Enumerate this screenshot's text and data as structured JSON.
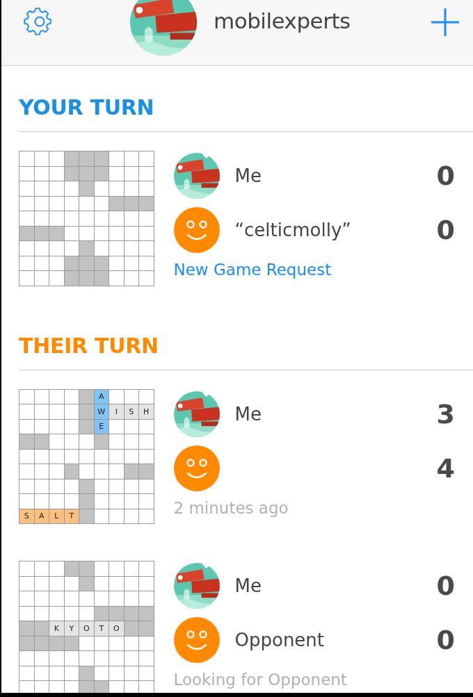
{
  "header": {
    "username": "mobilexperts"
  },
  "sections": [
    {
      "title": "YOUR TURN",
      "kind": "yours",
      "games": [
        {
          "board": [
            [
              {
                "kind": "empty"
              },
              {
                "kind": "empty"
              },
              {
                "kind": "empty"
              },
              {
                "kind": "blocked"
              },
              {
                "kind": "blocked"
              },
              {
                "kind": "blocked"
              },
              {
                "kind": "empty"
              },
              {
                "kind": "empty"
              },
              {
                "kind": "empty"
              }
            ],
            [
              {
                "kind": "empty"
              },
              {
                "kind": "empty"
              },
              {
                "kind": "empty"
              },
              {
                "kind": "blocked"
              },
              {
                "kind": "blocked"
              },
              {
                "kind": "blocked"
              },
              {
                "kind": "empty"
              },
              {
                "kind": "empty"
              },
              {
                "kind": "empty"
              }
            ],
            [
              {
                "kind": "empty"
              },
              {
                "kind": "empty"
              },
              {
                "kind": "empty"
              },
              {
                "kind": "empty"
              },
              {
                "kind": "blocked"
              },
              {
                "kind": "empty"
              },
              {
                "kind": "empty"
              },
              {
                "kind": "empty"
              },
              {
                "kind": "empty"
              }
            ],
            [
              {
                "kind": "empty"
              },
              {
                "kind": "empty"
              },
              {
                "kind": "empty"
              },
              {
                "kind": "empty"
              },
              {
                "kind": "empty"
              },
              {
                "kind": "empty"
              },
              {
                "kind": "blocked"
              },
              {
                "kind": "blocked"
              },
              {
                "kind": "blocked"
              }
            ],
            [
              {
                "kind": "empty"
              },
              {
                "kind": "empty"
              },
              {
                "kind": "empty"
              },
              {
                "kind": "empty"
              },
              {
                "kind": "empty"
              },
              {
                "kind": "empty"
              },
              {
                "kind": "empty"
              },
              {
                "kind": "empty"
              },
              {
                "kind": "empty"
              }
            ],
            [
              {
                "kind": "blocked"
              },
              {
                "kind": "blocked"
              },
              {
                "kind": "blocked"
              },
              {
                "kind": "empty"
              },
              {
                "kind": "empty"
              },
              {
                "kind": "empty"
              },
              {
                "kind": "empty"
              },
              {
                "kind": "empty"
              },
              {
                "kind": "empty"
              }
            ],
            [
              {
                "kind": "empty"
              },
              {
                "kind": "empty"
              },
              {
                "kind": "empty"
              },
              {
                "kind": "empty"
              },
              {
                "kind": "blocked"
              },
              {
                "kind": "empty"
              },
              {
                "kind": "empty"
              },
              {
                "kind": "empty"
              },
              {
                "kind": "empty"
              }
            ],
            [
              {
                "kind": "empty"
              },
              {
                "kind": "empty"
              },
              {
                "kind": "empty"
              },
              {
                "kind": "blocked"
              },
              {
                "kind": "blocked"
              },
              {
                "kind": "blocked"
              },
              {
                "kind": "empty"
              },
              {
                "kind": "empty"
              },
              {
                "kind": "empty"
              }
            ],
            [
              {
                "kind": "empty"
              },
              {
                "kind": "empty"
              },
              {
                "kind": "empty"
              },
              {
                "kind": "blocked"
              },
              {
                "kind": "blocked"
              },
              {
                "kind": "blocked"
              },
              {
                "kind": "empty"
              },
              {
                "kind": "empty"
              },
              {
                "kind": "empty"
              }
            ]
          ],
          "players": [
            {
              "name": "Me",
              "score": "0"
            },
            {
              "name": "“celticmolly”",
              "score": "0",
              "avatar": {
                "kind": "smiley"
              }
            }
          ],
          "status": {
            "kind": "link",
            "text": "New Game Request"
          }
        }
      ]
    },
    {
      "title": "THEIR TURN",
      "kind": "theirs",
      "games": [
        {
          "board": [
            [
              {
                "kind": "empty"
              },
              {
                "kind": "empty"
              },
              {
                "kind": "empty"
              },
              {
                "kind": "empty"
              },
              {
                "kind": "blocked"
              },
              {
                "kind": "letter",
                "letter": "A",
                "color": "#80c4f5"
              },
              {
                "kind": "empty"
              },
              {
                "kind": "empty"
              },
              {
                "kind": "empty"
              }
            ],
            [
              {
                "kind": "empty"
              },
              {
                "kind": "empty"
              },
              {
                "kind": "empty"
              },
              {
                "kind": "empty"
              },
              {
                "kind": "blocked"
              },
              {
                "kind": "letter",
                "letter": "W",
                "color": "#80c4f5"
              },
              {
                "kind": "letter",
                "letter": "I",
                "color": "#e4e4e4"
              },
              {
                "kind": "letter",
                "letter": "S",
                "color": "#e4e4e4"
              },
              {
                "kind": "letter",
                "letter": "H",
                "color": "#e4e4e4"
              }
            ],
            [
              {
                "kind": "empty"
              },
              {
                "kind": "empty"
              },
              {
                "kind": "empty"
              },
              {
                "kind": "empty"
              },
              {
                "kind": "blocked"
              },
              {
                "kind": "letter",
                "letter": "E",
                "color": "#80c4f5"
              },
              {
                "kind": "empty"
              },
              {
                "kind": "empty"
              },
              {
                "kind": "empty"
              }
            ],
            [
              {
                "kind": "blocked"
              },
              {
                "kind": "blocked"
              },
              {
                "kind": "empty"
              },
              {
                "kind": "empty"
              },
              {
                "kind": "empty"
              },
              {
                "kind": "blocked"
              },
              {
                "kind": "empty"
              },
              {
                "kind": "empty"
              },
              {
                "kind": "empty"
              }
            ],
            [
              {
                "kind": "empty"
              },
              {
                "kind": "empty"
              },
              {
                "kind": "empty"
              },
              {
                "kind": "empty"
              },
              {
                "kind": "empty"
              },
              {
                "kind": "empty"
              },
              {
                "kind": "empty"
              },
              {
                "kind": "empty"
              },
              {
                "kind": "empty"
              }
            ],
            [
              {
                "kind": "empty"
              },
              {
                "kind": "empty"
              },
              {
                "kind": "empty"
              },
              {
                "kind": "blocked"
              },
              {
                "kind": "empty"
              },
              {
                "kind": "empty"
              },
              {
                "kind": "empty"
              },
              {
                "kind": "blocked"
              },
              {
                "kind": "blocked"
              }
            ],
            [
              {
                "kind": "empty"
              },
              {
                "kind": "empty"
              },
              {
                "kind": "empty"
              },
              {
                "kind": "empty"
              },
              {
                "kind": "blocked"
              },
              {
                "kind": "empty"
              },
              {
                "kind": "empty"
              },
              {
                "kind": "empty"
              },
              {
                "kind": "empty"
              }
            ],
            [
              {
                "kind": "empty"
              },
              {
                "kind": "empty"
              },
              {
                "kind": "empty"
              },
              {
                "kind": "empty"
              },
              {
                "kind": "blocked"
              },
              {
                "kind": "empty"
              },
              {
                "kind": "empty"
              },
              {
                "kind": "empty"
              },
              {
                "kind": "empty"
              }
            ],
            [
              {
                "kind": "letter",
                "letter": "S",
                "color": "#fcc07e"
              },
              {
                "kind": "letter",
                "letter": "A",
                "color": "#fcc07e"
              },
              {
                "kind": "letter",
                "letter": "L",
                "color": "#fcc07e"
              },
              {
                "kind": "letter",
                "letter": "T",
                "color": "#fcc07e"
              },
              {
                "kind": "blocked"
              },
              {
                "kind": "empty"
              },
              {
                "kind": "empty"
              },
              {
                "kind": "empty"
              },
              {
                "kind": "empty"
              }
            ]
          ],
          "players": [
            {
              "name": "Me",
              "score": "3"
            },
            {
              "score": "4",
              "avatar": {
                "kind": "smiley"
              }
            }
          ],
          "status": {
            "kind": "time",
            "text": "2 minutes ago"
          }
        },
        {
          "board": [
            [
              {
                "kind": "empty"
              },
              {
                "kind": "empty"
              },
              {
                "kind": "empty"
              },
              {
                "kind": "blocked"
              },
              {
                "kind": "blocked"
              },
              {
                "kind": "empty"
              },
              {
                "kind": "empty"
              },
              {
                "kind": "empty"
              },
              {
                "kind": "empty"
              }
            ],
            [
              {
                "kind": "empty"
              },
              {
                "kind": "empty"
              },
              {
                "kind": "empty"
              },
              {
                "kind": "empty"
              },
              {
                "kind": "blocked"
              },
              {
                "kind": "empty"
              },
              {
                "kind": "empty"
              },
              {
                "kind": "empty"
              },
              {
                "kind": "empty"
              }
            ],
            [
              {
                "kind": "empty"
              },
              {
                "kind": "empty"
              },
              {
                "kind": "empty"
              },
              {
                "kind": "empty"
              },
              {
                "kind": "empty"
              },
              {
                "kind": "empty"
              },
              {
                "kind": "empty"
              },
              {
                "kind": "empty"
              },
              {
                "kind": "empty"
              }
            ],
            [
              {
                "kind": "empty"
              },
              {
                "kind": "empty"
              },
              {
                "kind": "empty"
              },
              {
                "kind": "empty"
              },
              {
                "kind": "empty"
              },
              {
                "kind": "blocked"
              },
              {
                "kind": "blocked"
              },
              {
                "kind": "blocked"
              },
              {
                "kind": "blocked"
              }
            ],
            [
              {
                "kind": "blocked"
              },
              {
                "kind": "blocked"
              },
              {
                "kind": "letter",
                "letter": "K",
                "color": "#e4e4e4"
              },
              {
                "kind": "letter",
                "letter": "Y",
                "color": "#e4e4e4"
              },
              {
                "kind": "letter",
                "letter": "O",
                "color": "#e4e4e4"
              },
              {
                "kind": "letter",
                "letter": "T",
                "color": "#e4e4e4"
              },
              {
                "kind": "letter",
                "letter": "O",
                "color": "#e4e4e4"
              },
              {
                "kind": "blocked"
              },
              {
                "kind": "blocked"
              }
            ],
            [
              {
                "kind": "blocked"
              },
              {
                "kind": "blocked"
              },
              {
                "kind": "blocked"
              },
              {
                "kind": "blocked"
              },
              {
                "kind": "empty"
              },
              {
                "kind": "empty"
              },
              {
                "kind": "empty"
              },
              {
                "kind": "empty"
              },
              {
                "kind": "empty"
              }
            ],
            [
              {
                "kind": "empty"
              },
              {
                "kind": "empty"
              },
              {
                "kind": "empty"
              },
              {
                "kind": "empty"
              },
              {
                "kind": "empty"
              },
              {
                "kind": "empty"
              },
              {
                "kind": "empty"
              },
              {
                "kind": "empty"
              },
              {
                "kind": "empty"
              }
            ],
            [
              {
                "kind": "empty"
              },
              {
                "kind": "empty"
              },
              {
                "kind": "empty"
              },
              {
                "kind": "empty"
              },
              {
                "kind": "blocked"
              },
              {
                "kind": "empty"
              },
              {
                "kind": "empty"
              },
              {
                "kind": "empty"
              },
              {
                "kind": "empty"
              }
            ],
            [
              {
                "kind": "empty"
              },
              {
                "kind": "empty"
              },
              {
                "kind": "empty"
              },
              {
                "kind": "empty"
              },
              {
                "kind": "blocked"
              },
              {
                "kind": "blocked"
              },
              {
                "kind": "empty"
              },
              {
                "kind": "empty"
              },
              {
                "kind": "empty"
              }
            ]
          ],
          "players": [
            {
              "name": "Me",
              "score": "0"
            },
            {
              "name": "Opponent",
              "score": "0",
              "avatar": {
                "kind": "smiley"
              }
            }
          ],
          "status": {
            "kind": "time",
            "text": "Looking for Opponent"
          }
        }
      ]
    }
  ]
}
